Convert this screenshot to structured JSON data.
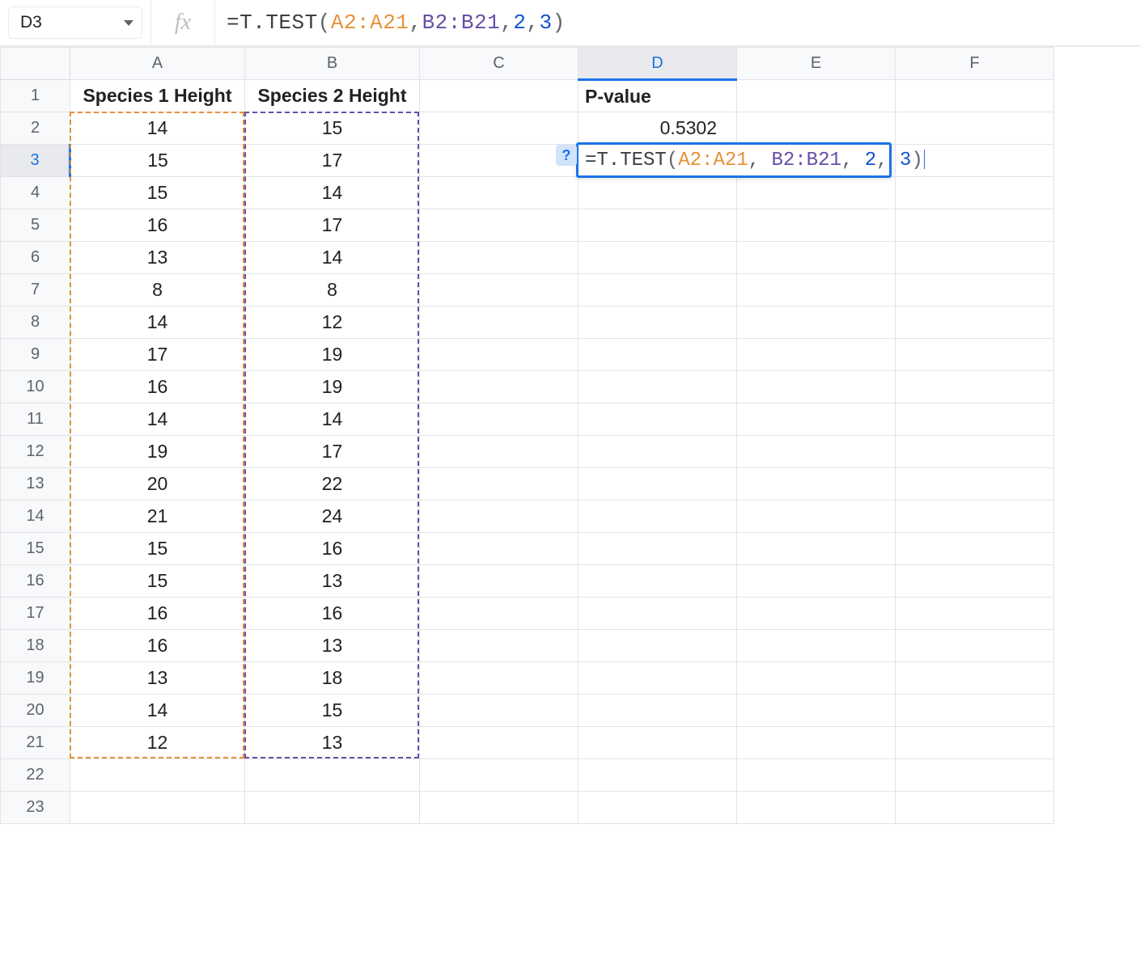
{
  "colors": {
    "active": "#1a73e8",
    "rangeA": "#e69138",
    "rangeB": "#674ea7",
    "number": "#1155cc"
  },
  "name_box": {
    "value": "D3"
  },
  "fx_label": "fx",
  "formula": {
    "prefix": "=",
    "fn": "T.TEST",
    "open": "(",
    "arg1": "A2:A21",
    "sep": ", ",
    "arg2": "B2:B21",
    "arg3": "2",
    "arg4": "3",
    "close": ")"
  },
  "column_headers": [
    "A",
    "B",
    "C",
    "D",
    "E",
    "F"
  ],
  "row_headers": [
    "1",
    "2",
    "3",
    "4",
    "5",
    "6",
    "7",
    "8",
    "9",
    "10",
    "11",
    "12",
    "13",
    "14",
    "15",
    "16",
    "17",
    "18",
    "19",
    "20",
    "21",
    "22",
    "23"
  ],
  "active_col": "D",
  "active_row": "3",
  "headers_row1": {
    "A": "Species 1 Height",
    "B": "Species 2 Height",
    "D": "P-value"
  },
  "cells_static": {
    "D2": "0.5302"
  },
  "species1": [
    "14",
    "15",
    "15",
    "16",
    "13",
    "8",
    "14",
    "17",
    "16",
    "14",
    "19",
    "20",
    "21",
    "15",
    "15",
    "16",
    "16",
    "13",
    "14",
    "12"
  ],
  "species2": [
    "15",
    "17",
    "14",
    "17",
    "14",
    "8",
    "12",
    "19",
    "19",
    "14",
    "17",
    "22",
    "24",
    "16",
    "13",
    "16",
    "13",
    "18",
    "15",
    "13"
  ],
  "edit_cell": {
    "ref": "D3",
    "help_icon": "?"
  },
  "range_highlight": {
    "A": {
      "top_row": 2,
      "bottom_row": 21,
      "col": "A"
    },
    "B": {
      "top_row": 2,
      "bottom_row": 21,
      "col": "B"
    }
  }
}
